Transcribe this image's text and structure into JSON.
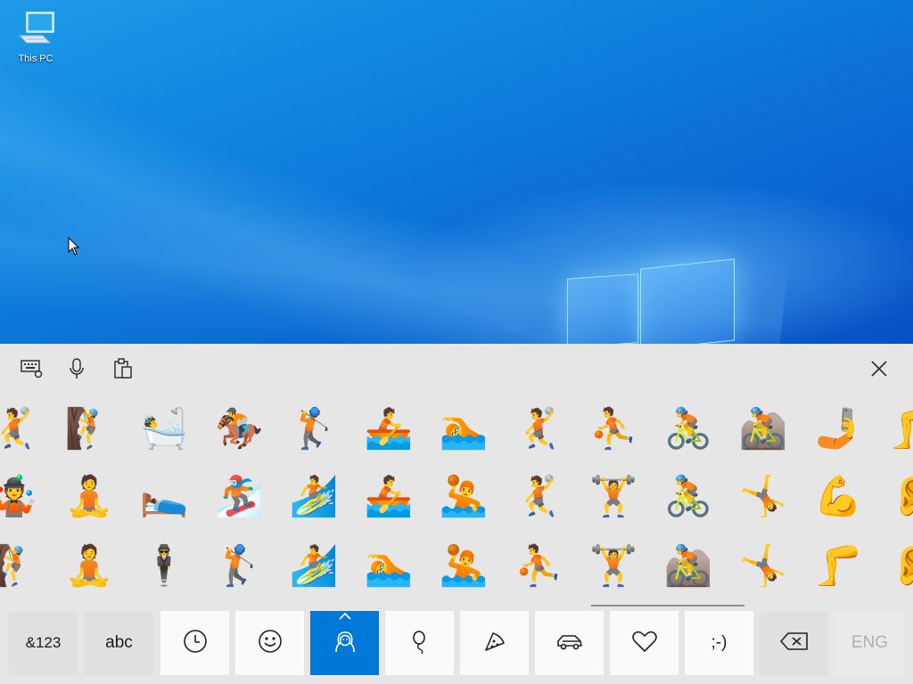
{
  "desktop": {
    "icons": [
      {
        "label": "This PC",
        "icon": "monitor-icon"
      }
    ]
  },
  "toolbar": {
    "keyboard_settings_icon": "keyboard-settings-icon",
    "voice_icon": "microphone-icon",
    "clipboard_icon": "clipboard-icon",
    "close_icon": "close-icon"
  },
  "emoji_rows": [
    [
      "🤾",
      "🧗",
      "🛀",
      "🏇",
      "🏌",
      "🚣",
      "🏊",
      "🤾",
      "⛹",
      "🚴",
      "🚵",
      "🤳",
      "🦵"
    ],
    [
      "🤹",
      "🧘",
      "🛌",
      "🏂",
      "🏄",
      "🚣",
      "🤽",
      "🤾",
      "🏋",
      "🚴",
      "🤸",
      "💪",
      "👂"
    ],
    [
      "🧗",
      "🧘",
      "🕴",
      "🏌",
      "🏄",
      "🏊",
      "🤽",
      "⛹",
      "🏋",
      "🚵",
      "🤸",
      "🦵",
      "👂"
    ]
  ],
  "bottom_keys": [
    {
      "label": "&123",
      "kind": "text",
      "style": "dark"
    },
    {
      "label": "abc",
      "kind": "text",
      "style": "dark"
    },
    {
      "label": "",
      "kind": "clock-icon",
      "style": "light"
    },
    {
      "label": "",
      "kind": "smiley-icon",
      "style": "light"
    },
    {
      "label": "",
      "kind": "person-icon",
      "style": "selected"
    },
    {
      "label": "",
      "kind": "balloon-icon",
      "style": "light"
    },
    {
      "label": "",
      "kind": "pizza-icon",
      "style": "light"
    },
    {
      "label": "",
      "kind": "car-icon",
      "style": "light"
    },
    {
      "label": "",
      "kind": "heart-icon",
      "style": "light"
    },
    {
      "label": ";-)",
      "kind": "text",
      "style": "light"
    },
    {
      "label": "",
      "kind": "backspace-icon",
      "style": "dark"
    },
    {
      "label": "ENG",
      "kind": "text",
      "style": "eng"
    }
  ],
  "colors": {
    "accent": "#0078d7",
    "keyboard_bg": "#e6e6e6",
    "key_light": "#fafafa",
    "key_dark": "#e0e0e0"
  }
}
